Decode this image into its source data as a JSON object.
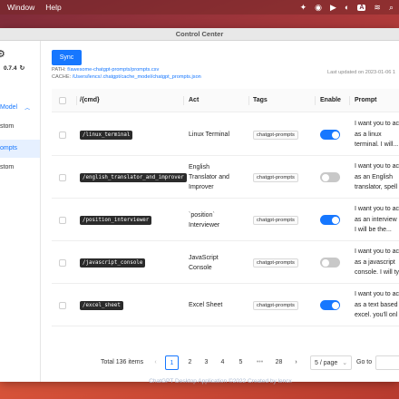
{
  "menubar": {
    "items": [
      "Window",
      "Help"
    ]
  },
  "window": {
    "title": "Control Center"
  },
  "sidebar": {
    "version": "0.7.4",
    "model_label": "Model",
    "items": [
      {
        "label": "stom"
      },
      {
        "label": "ompts"
      },
      {
        "label": "stom"
      }
    ]
  },
  "toolbar": {
    "sync_label": "Sync"
  },
  "paths": {
    "path_label": "PATH:",
    "path_value": "/Users/lencx/.chatgpt/cache_model/chatgpt_prompts.json",
    "path_url_value": "f/awesome-chatgpt-prompts/prompts.csv",
    "cache_label": "CACHE:",
    "updated": "Last updated on 2023-01-06 1"
  },
  "table": {
    "headers": {
      "cmd": "/{cmd}",
      "act": "Act",
      "tags": "Tags",
      "enable": "Enable",
      "prompt": "Prompt"
    },
    "rows": [
      {
        "cmd": "/linux_terminal",
        "act": [
          "Linux Terminal"
        ],
        "tag": "chatgpt-prompts",
        "enabled": true,
        "prompt": [
          "I want you to ac",
          "as a linux",
          "terminal. I will..."
        ]
      },
      {
        "cmd": "/english_translator_and_improver",
        "act": [
          "English",
          "Translator and",
          "Improver"
        ],
        "tag": "chatgpt-prompts",
        "enabled": false,
        "prompt": [
          "I want you to ac",
          "as an English",
          "translator, spell"
        ]
      },
      {
        "cmd": "/position_interviewer",
        "act": [
          "`position`",
          "Interviewer"
        ],
        "tag": "chatgpt-prompts",
        "enabled": true,
        "prompt": [
          "I want you to ac",
          "as an interview",
          "I will be the..."
        ]
      },
      {
        "cmd": "/javascript_console",
        "act": [
          "JavaScript",
          "Console"
        ],
        "tag": "chatgpt-prompts",
        "enabled": false,
        "prompt": [
          "I want you to ac",
          "as a javascript",
          "console. I will ty"
        ]
      },
      {
        "cmd": "/excel_sheet",
        "act": [
          "Excel Sheet"
        ],
        "tag": "chatgpt-prompts",
        "enabled": true,
        "prompt": [
          "I want you to ac",
          "as a text based",
          "excel. you'll onl"
        ]
      }
    ]
  },
  "pagination": {
    "total": "Total 136 items",
    "pages": [
      "1",
      "2",
      "3",
      "4",
      "5",
      "•••",
      "28"
    ],
    "current": "1",
    "page_size": "5 / page",
    "goto_label": "Go to"
  },
  "footer": {
    "text": "ChatGPT Desktop Application ©2022 Created by lencx"
  },
  "colors": {
    "accent": "#1677ff",
    "tag_dark": "#2b2b2b"
  }
}
